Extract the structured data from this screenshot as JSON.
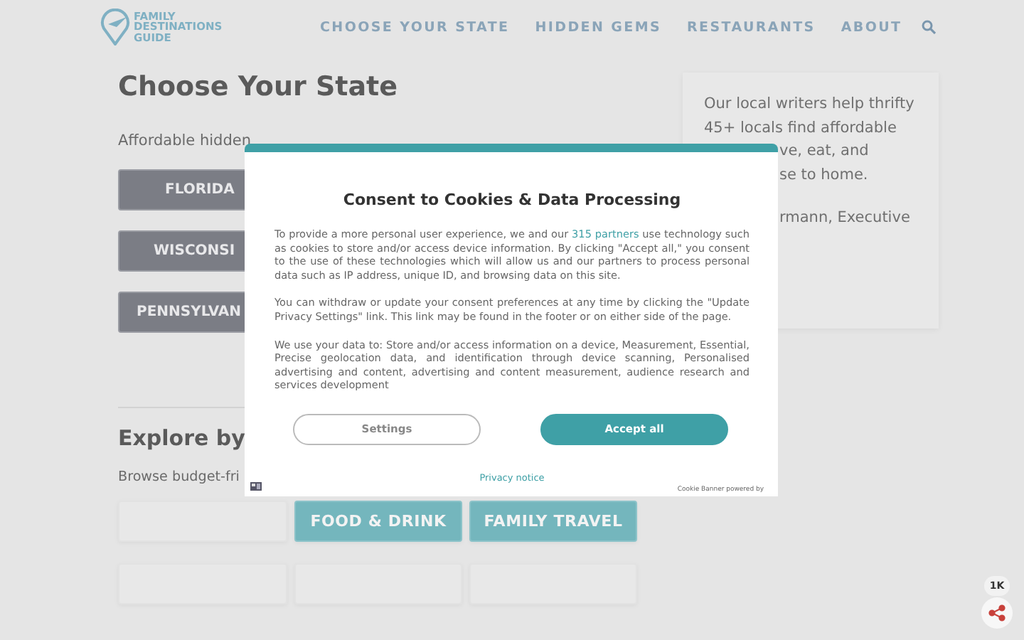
{
  "header": {
    "logo": [
      "FAMILY",
      "DESTINATIONS",
      "GUIDE"
    ],
    "nav": [
      {
        "label": "CHOOSE YOUR STATE"
      },
      {
        "label": "HIDDEN GEMS"
      },
      {
        "label": "RESTAURANTS"
      },
      {
        "label": "ABOUT"
      }
    ]
  },
  "main": {
    "title": "Choose Your State",
    "subtitle": "Affordable hidden",
    "states": [
      "FLORIDA",
      "WISCONSI",
      "PENNSYLVAN"
    ],
    "explore_title": "Explore by",
    "explore_text": "Browse budget-fri",
    "tiles": [
      {
        "kind": "blank"
      },
      {
        "kind": "label",
        "label": "FOOD & DRINK"
      },
      {
        "kind": "label",
        "label": "FAMILY TRAVEL"
      },
      {
        "kind": "blank"
      },
      {
        "kind": "blank"
      },
      {
        "kind": "blank"
      }
    ]
  },
  "about_card": {
    "lines": [
      "Our local writers help thrifty",
      "45+ locals find affordable"
    ],
    "partial_lines": [
      "ve, eat, and",
      "se to home."
    ],
    "byline": "rmann, Executive"
  },
  "share": {
    "count": "1K"
  },
  "consent": {
    "title": "Consent to Cookies & Data Processing",
    "paragraphs": [
      "To provide a more personal user experience, we and our ",
      "You can withdraw or update your consent preferences at any time by clicking the \"Update Privacy Settings\" link. This link may be found in the footer or on either side of the page.",
      "We use your data to: Store and/or access information on a device, Measurement, Essential, Precise geolocation data, and identification through device scanning, Personalised advertising and content, advertising and content measurement, audience research and services development"
    ],
    "partners_link": "315 partners",
    "after_link": " use technology such as cookies to store and/or access device information. By clicking \"Accept all,\" you consent to the use of these technologies which will allow us and our partners to process personal data such as IP address, unique ID, and browsing data on this site.",
    "buttons": [
      {
        "label": "Settings",
        "kind": "outline"
      },
      {
        "label": "Accept all",
        "kind": "primary"
      }
    ],
    "privacy_link": "Privacy notice",
    "powered_by": "Cookie Banner powered by"
  }
}
